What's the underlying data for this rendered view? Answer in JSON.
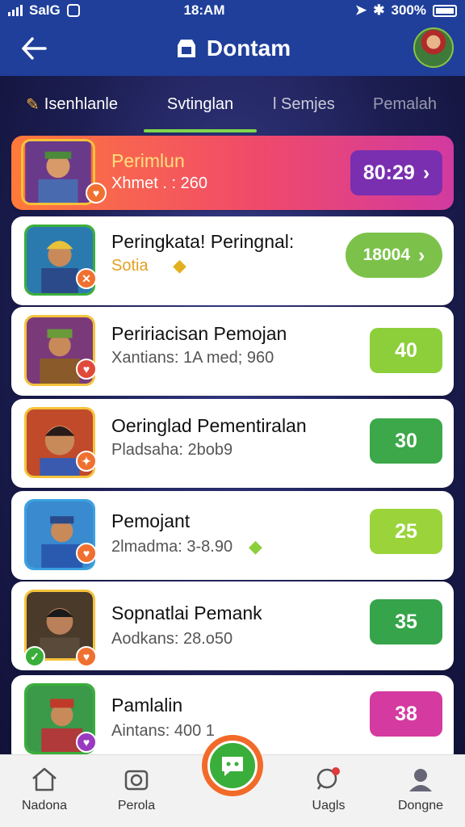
{
  "status_bar": {
    "carrier": "SaIG",
    "time": "18:AM",
    "battery": "300%"
  },
  "header": {
    "title": "Dontam"
  },
  "tabs": [
    {
      "label": "Isenhlanle",
      "icon": "wrench-icon"
    },
    {
      "label": "Svtinglan",
      "active": true
    },
    {
      "label": "l Semjes"
    },
    {
      "label": "Pemalah"
    }
  ],
  "rows": [
    {
      "title": "Perimlun",
      "subtitle": "Xhmet . : 260",
      "score": "80:29",
      "score_color": "#7a2fb0",
      "badge_color": "#f07030",
      "highlight": true,
      "has_chevron": true
    },
    {
      "title": "Peringkata! Peringnal:",
      "subtitle": "Sotia",
      "score": "18004",
      "score_color": "#7cc24a",
      "badge_color": "#f07030",
      "badge_glyph": "✕",
      "has_chevron": true,
      "subtitle_color": "#e2a020"
    },
    {
      "title": "Peririacisan Pemojan",
      "subtitle": "Xantians: 1A med; 960",
      "score": "40",
      "score_color": "#8ccf3a",
      "badge_color": "#e04a3a"
    },
    {
      "title": "Oeringlad Pementiralan",
      "subtitle": "Pladsaha: 2bob9",
      "score": "30",
      "score_color": "#3ca84a",
      "badge_color": "#f07030"
    },
    {
      "title": "Pemojant",
      "subtitle": "2lmadma: 3-8.90",
      "score": "25",
      "score_color": "#9ad43a",
      "badge_color": "#f07030"
    },
    {
      "title": "Sopnatlai Pemank",
      "subtitle": "Aodkans: 28.o50",
      "score": "35",
      "score_color": "#36a44a",
      "badge_color": "#f07030",
      "extra_badge_color": "#3aae3a"
    },
    {
      "title": "Pamlalin",
      "subtitle": "Aintans: 400 1",
      "score": "38",
      "score_color": "#d43aa0",
      "badge_color": "#9a3ac0"
    }
  ],
  "bottom_nav": [
    {
      "label": "Nadona",
      "icon": "home-icon"
    },
    {
      "label": "Perola",
      "icon": "camera-icon"
    },
    {
      "label": "",
      "icon": "chat-bubble-icon"
    },
    {
      "label": "Uagls",
      "icon": "search-icon"
    },
    {
      "label": "Dongne",
      "icon": "profile-icon"
    }
  ]
}
